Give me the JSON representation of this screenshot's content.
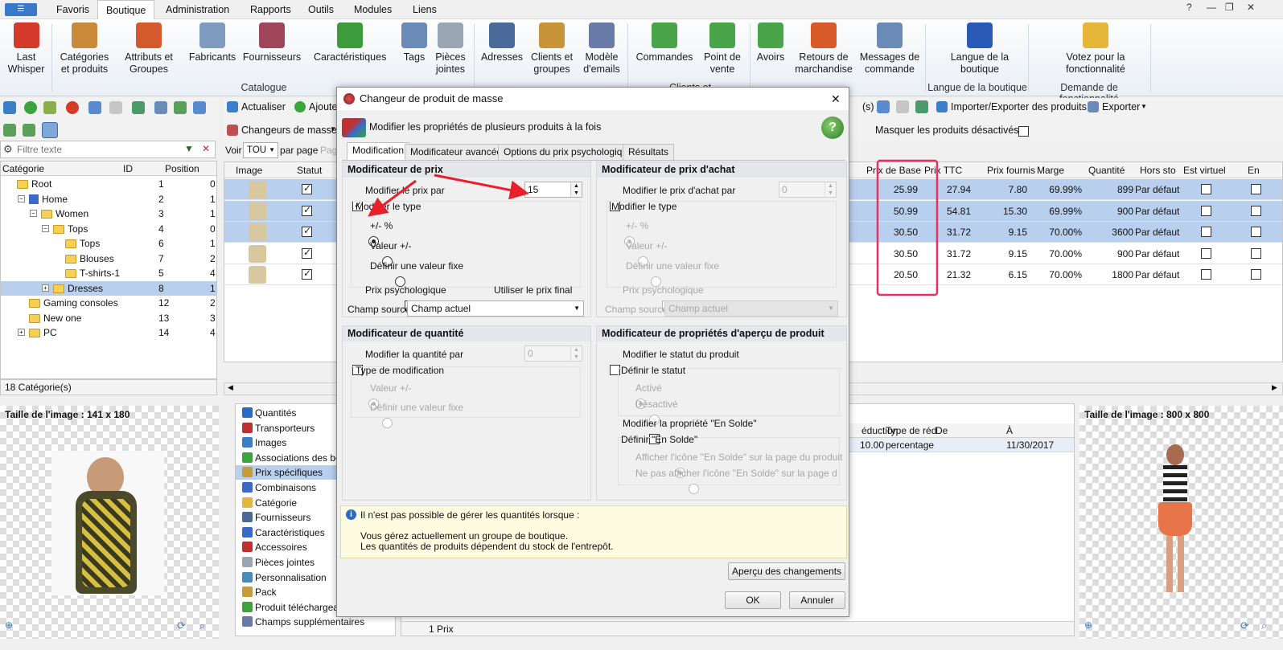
{
  "menu": {
    "tabs": [
      "Favoris",
      "Boutique",
      "Administration",
      "Rapports",
      "Outils",
      "Modules",
      "Liens"
    ],
    "active": "Boutique"
  },
  "ribbon": {
    "buttons": [
      {
        "label": "Last Whisper",
        "color": "#d43a2a"
      },
      {
        "label": "Catégories et produits",
        "color": "#c98a3a"
      },
      {
        "label": "Attributs et Groupes",
        "color": "#d35a2c"
      },
      {
        "label": "Fabricants",
        "color": "#7f9bc0"
      },
      {
        "label": "Fournisseurs",
        "color": "#a0465a"
      },
      {
        "label": "Caractéristiques",
        "color": "#3c9c3c"
      },
      {
        "label": "Tags",
        "color": "#6a8ab8"
      },
      {
        "label": "Pièces jointes",
        "color": "#9aa5b4"
      },
      {
        "label": "Adresses",
        "color": "#4a6a9a"
      },
      {
        "label": "Clients et groupes",
        "color": "#c7943a"
      },
      {
        "label": "Modèle d'emails",
        "color": "#6a7aa8"
      },
      {
        "label": "Commandes",
        "color": "#4aa54a"
      },
      {
        "label": "Point de vente",
        "color": "#4aa54a"
      },
      {
        "label": "Avoirs",
        "color": "#4aa54a"
      },
      {
        "label": "Retours de marchandise",
        "color": "#d85a28"
      },
      {
        "label": "Messages de commande",
        "color": "#6a8ab8"
      },
      {
        "label": "Langue de la boutique",
        "color": "#2a5ab8"
      },
      {
        "label": "Votez pour la fonctionnalité",
        "color": "#e6b63a"
      }
    ],
    "groups": {
      "catalogue": "Catalogue",
      "clients": "Clients et Commandes",
      "langue": "Langue de la boutique",
      "demande": "Demande de fonctionnalité"
    }
  },
  "left": {
    "filter_placeholder": "Filtre texte",
    "headers": {
      "cat": "Catégorie",
      "id": "ID",
      "pos": "Position"
    },
    "tree": [
      {
        "name": "Root",
        "id": "1",
        "pos": "0"
      },
      {
        "name": "Home",
        "id": "2",
        "pos": "1"
      },
      {
        "name": "Women",
        "id": "3",
        "pos": "1"
      },
      {
        "name": "Tops",
        "id": "4",
        "pos": "0"
      },
      {
        "name": "Tops",
        "id": "6",
        "pos": "1"
      },
      {
        "name": "Blouses",
        "id": "7",
        "pos": "2"
      },
      {
        "name": "T-shirts-1",
        "id": "5",
        "pos": "4"
      },
      {
        "name": "Dresses",
        "id": "8",
        "pos": "1"
      },
      {
        "name": "Gaming consoles",
        "id": "12",
        "pos": "2"
      },
      {
        "name": "New one",
        "id": "13",
        "pos": "3"
      },
      {
        "name": "PC",
        "id": "14",
        "pos": "4"
      }
    ],
    "count": "18 Catégorie(s)",
    "image_size": "Taille de l'image : 141 x 180"
  },
  "center": {
    "refresh": "Actualiser",
    "add": "Ajoute",
    "changers": "Changeurs de masse",
    "voir": "Voir",
    "tou": "TOU",
    "per_page": "par page",
    "page_cut": "Pag",
    "col_image": "Image",
    "col_status": "Statut",
    "bottom_list": [
      "Quantités",
      "Transporteurs",
      "Images",
      "Associations des bout",
      "Prix spécifiques",
      "Combinaisons",
      "Catégorie",
      "Fournisseurs",
      "Caractéristiques",
      "Accessoires",
      "Pièces jointes",
      "Personnalisation",
      "Pack",
      "Produit téléchargeabl",
      "Champs supplémentaires"
    ],
    "bottom_selected": "Prix spécifiques",
    "prix_count": "1 Prix"
  },
  "right": {
    "toolbar": {
      "import_export": "Importer/Exporter des produits",
      "export": "Exporter",
      "hide_label": "Masquer les produits désactivés",
      "cut": "(s)"
    },
    "headers": [
      "Prix de Base",
      "Prix TTC",
      "Prix fournis",
      "Marge",
      "Quantité",
      "Hors sto",
      "Est virtuel",
      "En"
    ],
    "rows": [
      {
        "base": "25.99",
        "ttc": "27.94",
        "fourn": "7.80",
        "marge": "69.99%",
        "qte": "899",
        "hors": "Par défaut",
        "sel": true
      },
      {
        "base": "50.99",
        "ttc": "54.81",
        "fourn": "15.30",
        "marge": "69.99%",
        "qte": "900",
        "hors": "Par défaut",
        "sel": true
      },
      {
        "base": "30.50",
        "ttc": "31.72",
        "fourn": "9.15",
        "marge": "70.00%",
        "qte": "3600",
        "hors": "Par défaut",
        "sel": true
      },
      {
        "base": "30.50",
        "ttc": "31.72",
        "fourn": "9.15",
        "marge": "70.00%",
        "qte": "900",
        "hors": "Par défaut",
        "sel": false
      },
      {
        "base": "20.50",
        "ttc": "21.32",
        "fourn": "6.15",
        "marge": "70.00%",
        "qte": "1800",
        "hors": "Par défaut",
        "sel": false
      }
    ],
    "sp_headers": {
      "reduction": "éduction",
      "type": "Type de réd",
      "de": "De",
      "a": "À"
    },
    "sp_row": {
      "reduction": "10.00",
      "type": "percentage",
      "de": "",
      "a": "11/30/2017"
    },
    "image_size": "Taille de l'image : 800 x 800"
  },
  "dialog": {
    "title": "Changeur de produit de masse",
    "subtitle": "Modifier les propriétés de plusieurs produits à la fois",
    "tabs": [
      "Modification",
      "Modificateur avancée",
      "Options du prix psychologique",
      "Résultats"
    ],
    "price": {
      "head": "Modificateur de prix",
      "modify": "Modifier le prix par",
      "value": "15",
      "type_label": "Modifier le type",
      "opt1": "+/- %",
      "opt2": "Valeur +/-",
      "opt3": "Définir une valeur fixe",
      "psy": "Prix psychologique",
      "final": "Utiliser le prix final",
      "source_label": "Champ source",
      "source": "Champ actuel"
    },
    "purchase": {
      "head": "Modificateur de prix d'achat",
      "modify": "Modifier le prix d'achat par",
      "value": "0",
      "type_label": "Modifier le type",
      "opt1": "+/- %",
      "opt2": "Valeur +/-",
      "opt3": "Définir une valeur fixe",
      "psy": "Prix psychologique",
      "source_label": "Champ source",
      "source": "Champ actuel"
    },
    "qty": {
      "head": "Modificateur de quantité",
      "modify": "Modifier la quantité par",
      "value": "0",
      "type_label": "Type de modification",
      "opt1": "Valeur +/-",
      "opt2": "Définir une valeur fixe"
    },
    "preview": {
      "head": "Modificateur de propriétés d'aperçu de produit",
      "status": "Modifier le statut du produit",
      "define": "Définir le statut",
      "on": "Activé",
      "off": "Désactivé",
      "sale": "Modifier la propriété \"En Solde\"",
      "define_sale": "Définir \"En Solde\"",
      "show": "Afficher l'icône \"En Solde\" sur la page du produit",
      "hide": "Ne pas afficher l'icône \"En Solde\" sur la page du produ"
    },
    "info": {
      "line1": "Il n'est pas possible de gérer les quantités lorsque :",
      "line2": "Vous gérez actuellement un groupe de boutique.",
      "line3": "Les quantités de produits dépendent du stock de l'entrepôt."
    },
    "preview_btn": "Aperçu des changements",
    "ok": "OK",
    "cancel": "Annuler"
  }
}
